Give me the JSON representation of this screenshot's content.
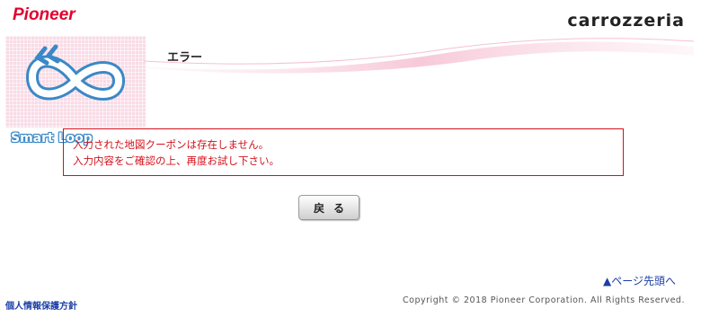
{
  "header": {
    "brand_left": "Pioneer",
    "brand_right": "carrozzeria",
    "product_logo_text": "Smart Loop"
  },
  "main": {
    "title": "エラー",
    "error_lines": [
      "入力された地図クーポンは存在しません。",
      "入力内容をご確認の上、再度お試し下さい。"
    ],
    "back_button_label": "戻る"
  },
  "footer": {
    "page_top_link": "▲ページ先頭へ",
    "privacy_link": "個人情報保護方針",
    "copyright": "Copyright © 2018 Pioneer Corporation. All Rights Reserved."
  },
  "colors": {
    "brand_red": "#e3002d",
    "error_red": "#d2121c",
    "link_blue": "#1b3fa6",
    "logo_pink": "#f9dbe6"
  }
}
